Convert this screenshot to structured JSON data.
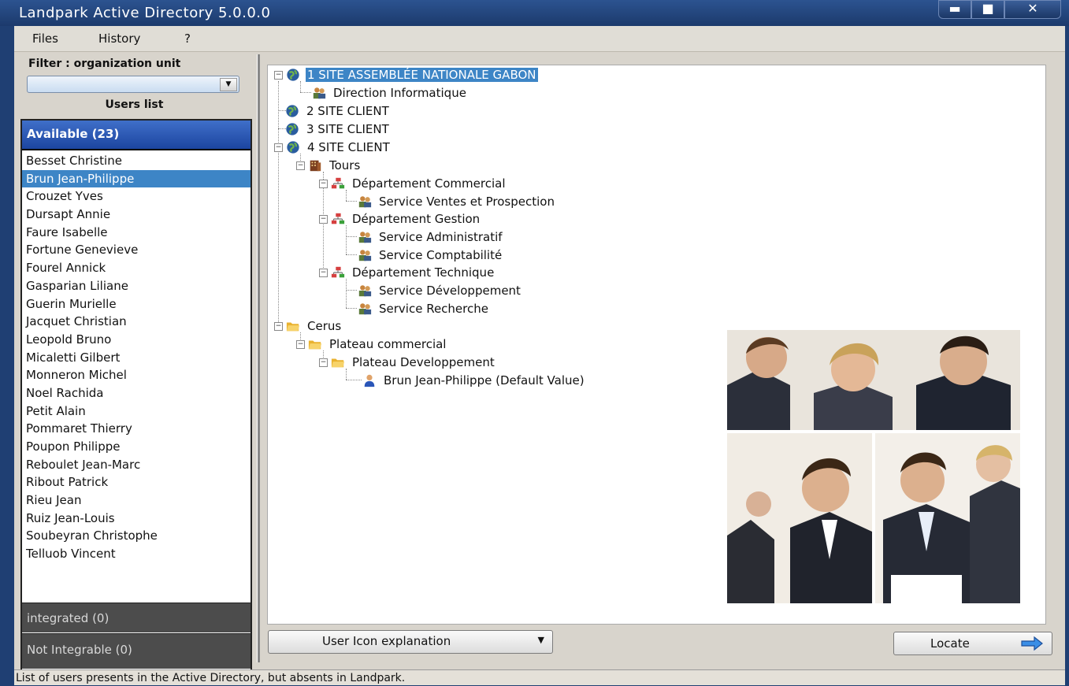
{
  "window": {
    "title": "Landpark Active Directory 5.0.0.0",
    "min_glyph": "▬",
    "max_glyph": "■",
    "close_glyph": "✕"
  },
  "menu": [
    "Files",
    "History",
    "?"
  ],
  "filter": {
    "label": "Filter : organization unit",
    "value": ""
  },
  "users_list": {
    "title": "Users list",
    "available_label": "Available (23)",
    "selected_index": 1,
    "users": [
      "Besset Christine",
      "Brun Jean-Philippe",
      "Crouzet Yves",
      "Dursapt Annie",
      "Faure Isabelle",
      "Fortune Genevieve",
      "Fourel Annick",
      "Gasparian Liliane",
      "Guerin Murielle",
      "Jacquet Christian",
      "Leopold Bruno",
      "Micaletti Gilbert",
      "Monneron Michel",
      "Noel Rachida",
      "Petit Alain",
      "Pommaret Thierry",
      "Poupon Philippe",
      "Reboulet Jean-Marc",
      "Ribout Patrick",
      "Rieu Jean",
      "Ruiz Jean-Louis",
      "Soubeyran Christophe",
      "Telluob Vincent"
    ],
    "integrated_label": "integrated (0)",
    "not_integrable_label": "Not Integrable (0)"
  },
  "tree": {
    "n1": "1 SITE ASSEMBLÉE NATIONALE GABON",
    "n2": "Direction Informatique",
    "n3": "2 SITE CLIENT",
    "n4": "3 SITE CLIENT",
    "n5": "4 SITE CLIENT",
    "n6": "Tours",
    "n7": "Département Commercial",
    "n8": "Service Ventes et Prospection",
    "n9": "Département Gestion",
    "n10": "Service Administratif",
    "n11": "Service Comptabilité",
    "n12": "Département Technique",
    "n13": "Service Développement",
    "n14": "Service Recherche",
    "n15": "Cerus",
    "n16": "Plateau commercial",
    "n17": "Plateau Developpement",
    "n18": "Brun Jean-Philippe (Default Value)"
  },
  "icons": {
    "site": "globe-icon",
    "org": "group-icon",
    "building": "building-icon",
    "department": "org-chart-icon",
    "folder": "folder-icon",
    "user": "user-icon"
  },
  "buttons": {
    "icon_explanation": "User Icon explanation",
    "locate": "Locate"
  },
  "status_bar": "List of users presents in the Active Directory, but absents in Landpark.",
  "colors": {
    "selection": "#3d85c6",
    "header_blue": "#1c45a0",
    "title_bar": "#1f3f73"
  }
}
